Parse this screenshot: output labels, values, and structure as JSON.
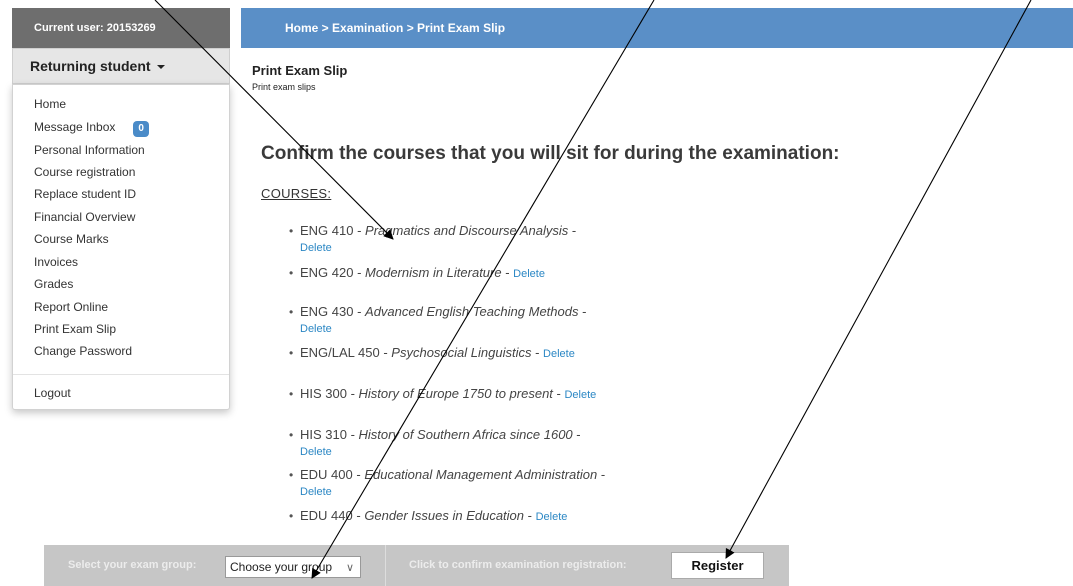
{
  "sidebar": {
    "current_user": "Current user: 20153269",
    "role_dropdown": "Returning student",
    "menu": [
      "Home",
      "Message Inbox",
      "Personal Information",
      "Course registration",
      "Replace student ID",
      "Financial Overview",
      "Course Marks",
      "Invoices",
      "Grades",
      "Report Online",
      "Print Exam Slip",
      "Change Password"
    ],
    "inbox_badge": "0",
    "logout": "Logout"
  },
  "header": {
    "breadcrumb": "Home > Examination > Print Exam Slip"
  },
  "main": {
    "title": "Print Exam Slip",
    "subtitle": "Print exam slips",
    "heading": "Confirm the courses that you will sit for during the examination:",
    "courses_label": "COURSES:",
    "delete_label": "Delete",
    "courses": [
      {
        "code": "ENG 410 - ",
        "title": "Pragmatics and Discourse Analysis",
        "sep": " - "
      },
      {
        "code": "ENG 420 - ",
        "title": "Modernism in Literature",
        "sep": " - "
      },
      {
        "code": "ENG 430 - ",
        "title": "Advanced English Teaching Methods",
        "sep": " - "
      },
      {
        "code": "ENG/LAL 450 - ",
        "title": "Psychosocial Linguistics",
        "sep": " - "
      },
      {
        "code": "HIS 300 - ",
        "title": "History of Europe 1750 to present",
        "sep": " - "
      },
      {
        "code": "HIS 310 - ",
        "title": "History of Southern Africa since 1600",
        "sep": " - "
      },
      {
        "code": "EDU 400 - ",
        "title": "Educational Management Administration",
        "sep": " - "
      },
      {
        "code": "EDU 440 - ",
        "title": "Gender Issues in Education",
        "sep": " - "
      }
    ]
  },
  "footer": {
    "group_label": "Select your exam group:",
    "group_value": "Choose your group",
    "confirm_label": "Click to confirm examination registration:",
    "register_button": "Register"
  }
}
